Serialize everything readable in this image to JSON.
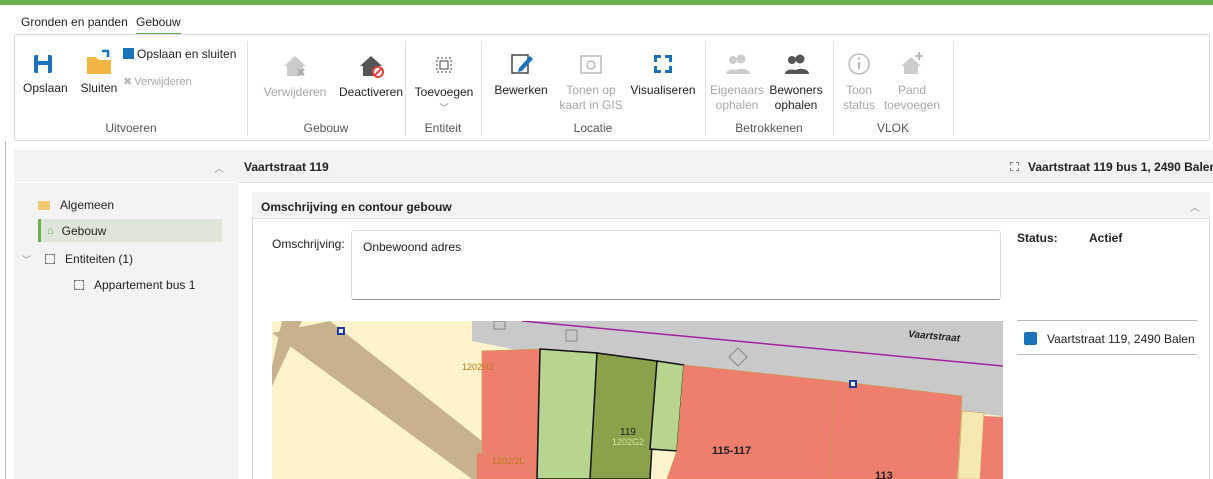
{
  "tabs": [
    "Gronden en panden",
    "Gebouw"
  ],
  "ribbon": {
    "uitvoeren": {
      "opslaan": "Opslaan",
      "sluiten": "Sluiten",
      "opslaan_sluiten": "Opslaan en sluiten",
      "verwijderen": "Verwijderen",
      "group": "Uitvoeren"
    },
    "gebouw": {
      "verwijderen": "Verwijderen",
      "deactiveren": "Deactiveren",
      "group": "Gebouw"
    },
    "entiteit": {
      "toevoegen": "Toevoegen",
      "group": "Entiteit"
    },
    "locatie": {
      "bewerken": "Bewerken",
      "tonen_1": "Tonen op",
      "tonen_2": "kaart in GIS",
      "visualiseren": "Visualiseren",
      "group": "Locatie"
    },
    "betrokkenen": {
      "eig_1": "Eigenaars",
      "eig_2": "ophalen",
      "bew_1": "Bewoners",
      "bew_2": "ophalen",
      "group": "Betrokkenen"
    },
    "vlok": {
      "toon_1": "Toon",
      "toon_2": "status",
      "pand_1": "Pand",
      "pand_2": "toevoegen",
      "group": "VLOK"
    }
  },
  "sidebar": {
    "items": [
      {
        "label": "Algemeen"
      },
      {
        "label": "Gebouw"
      },
      {
        "label": "Entiteiten (1)"
      },
      {
        "label": "Appartement bus 1"
      }
    ]
  },
  "main": {
    "title": "Vaartstraat 119",
    "unit_link": "Vaartstraat 119 bus 1, 2490 Balen",
    "panel_title": "Omschrijving en contour gebouw",
    "omschrijving_label": "Omschrijving:",
    "omschrijving_value": "Onbewoond adres",
    "status_label": "Status:",
    "status_value": "Actief",
    "address": "Vaartstraat 119, 2490 Balen"
  },
  "map": {
    "street": "Vaartstraat",
    "parcels": [
      "1202H2",
      "1202/2L",
      "119",
      "1202G2",
      "115-117",
      "113"
    ]
  },
  "colors": {
    "accent": "#6ab04c",
    "parcel_red": "#f07e6e",
    "parcel_green": "#b7d58f",
    "parcel_darkgreen": "#8ca24a"
  }
}
